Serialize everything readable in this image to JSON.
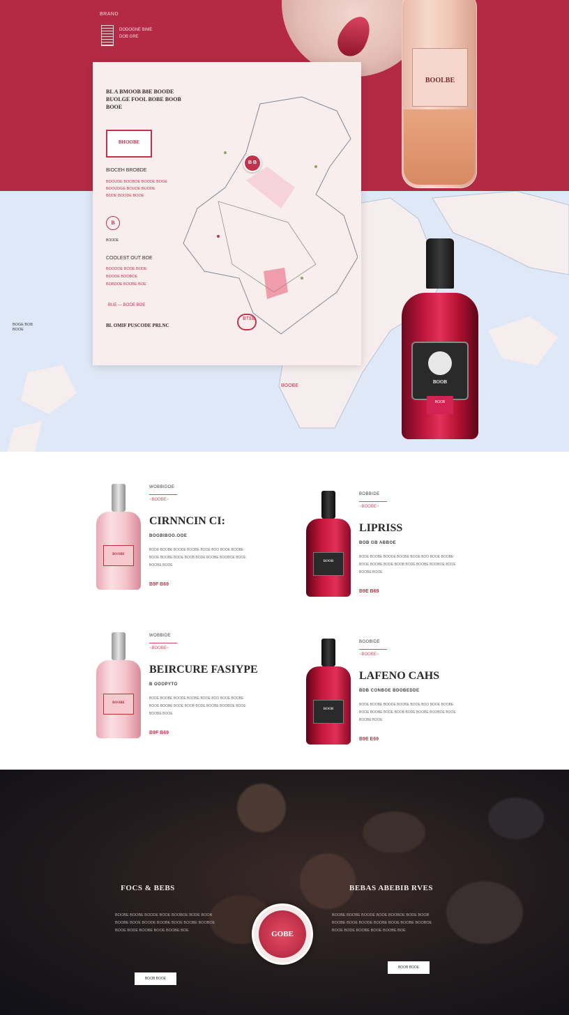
{
  "header": {
    "small_label": "BRAND",
    "text_lines": [
      "DODOGNE BIME",
      "DOB GRE"
    ]
  },
  "map_card": {
    "title": "BL A BMOOB B8E BOODE BUOLGE FOOL BOBE BOOB BOOE",
    "stamp": "BHOOBE",
    "sub_heading": "BIOCEH BROBDE",
    "lines": [
      "BOOUDE BOOBOE BOODE BOGE",
      "BOOUDGE BOUOE BUODE",
      "BODE BOODE BOOE"
    ],
    "circle_mark": "B",
    "rule_text": "BOODE",
    "sub_heading2": "COOLEST OUT BOE",
    "lines2": [
      "BOODOE BOOE BODE",
      "BOODE BOOBOE",
      "BOBDOE BOOBE BOE"
    ],
    "scribble": "BUE — BOOE BOE",
    "footer": "BL OMIF PUSCODE PRLNC",
    "pin_label": "B B",
    "map_stamp": "BTEB"
  },
  "hero": {
    "bowl_bottle_label": "BOOLBE",
    "big_bottle_label": "BOOB",
    "big_bottle_tag": "BOOB",
    "map_side_label": [
      "BOGE BOB",
      "BOOE"
    ],
    "map_red_label": "BOOBE"
  },
  "products": [
    {
      "category": "WOBBIDOE",
      "ornament": "~BOOBE~",
      "name": "CIRNNCIN CI:",
      "subtitle": "BOGBIBOO.OOE",
      "bottle_label": "BOOBE",
      "desc": "BODE BOOBE BOODE BOOBE BOOE BOO BOOE BOOBE BOOE BOOBE BODE BOOB BODE BOOBE BOOBOE BOOE BOOBE BOOE",
      "price": "B9F B69"
    },
    {
      "category": "BOBBIDE",
      "ornament": "~BOOBE~",
      "name": "LIPRISS",
      "subtitle": "BOB GB ABBOE",
      "bottle_label": "BOOB",
      "desc": "BODE BOOBE BOODE BOOBE BOOE BOO BOOE BOOBE BOOE BOOBE BODE BOOB BODE BOOBE BOOBOE BOOE BOOBE BOOE",
      "price": "B9E B69"
    },
    {
      "category": "WOBBIDE",
      "ornament": "~BOOBE~",
      "name": "BEIRCURE FASIYPE",
      "subtitle": "B OOOPYTO",
      "bottle_label": "BOOBE",
      "desc": "BODE BOOBE BOODE BOOBE BOOE BOO BOOE BOOBE BOOE BOOBE BODE BOOB BODE BOOBE BOOBOE BOOE BOOBE BOOE",
      "price": "B9F B69"
    },
    {
      "category": "BOOBIDE",
      "ornament": "~BOOBE~",
      "name": "LAFENO CAHS",
      "subtitle": "BDB CONBOE BDOBEDDE",
      "bottle_label": "BOOB",
      "desc": "BODE BOOBE BOODE BOOBE BOOE BOO BOOE BOOBE BOOE BOOBE BODE BOOB BODE BOOBE BOOBOE BOOE BOOBE BOOE",
      "price": "B9E E69"
    }
  ],
  "footer": {
    "left_title": "FOCS & BEBS",
    "left_text": "BOOBE BOOBE BOODE BOOE BOOBOE BODE BOOB BOOBE BOOE BOODE BOOBE BOOE BOOBE BOOBOE BOOE BODE BOOBE BOOE BOOBE BOE",
    "left_button": "BOOB BOOE",
    "right_title": "BEBAS ABEBIB RVES",
    "right_text": "BOOBE BOOBE BOODE BOOE BOOBOE BODE BOOB BOOBE BOOE BOODE BOOBE BOOE BOOBE BOOBOE BOOE BODE BOOBE BOOE BOOBE BOE",
    "right_button": "BOOB BOOE",
    "seal": "GOBE"
  },
  "colors": {
    "brand_red": "#b42a45",
    "accent_red": "#c2334b",
    "map_blue": "#dfe8f6",
    "card_bg": "#f9eeee",
    "footer_dark": "#1c171a"
  }
}
